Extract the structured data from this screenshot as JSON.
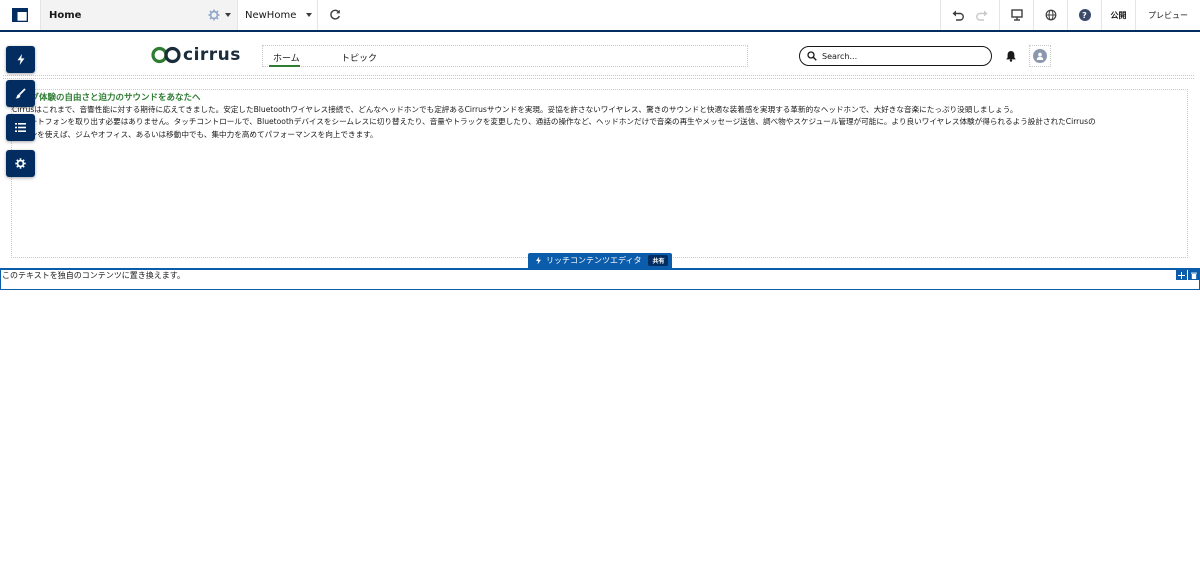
{
  "topbar": {
    "page_name": "Home",
    "view_name": "NewHome",
    "publish_label": "公開",
    "preview_label": "プレビュー"
  },
  "site": {
    "logo_text": "cirrus",
    "nav": [
      {
        "label": "ホーム",
        "active": true
      },
      {
        "label": "トピック",
        "active": false
      }
    ],
    "search_placeholder": "Search..."
  },
  "content": {
    "heading": "ング体験の自由さと迫力のサウンドをあなたへ",
    "lines": [
      "Cirrusはこれまで、音響性能に対する期待に応えてきました。安定したBluetoothワイヤレス接続で、どんなヘッドホンでも定評あるCirrusサウンドを実現。妥協を許さないワイヤレス、驚きのサウンドと快適な装着感を実現する革新的なヘッドホンで、大好きな音楽にたっぷり没頭しましょう。",
      "マートフォンを取り出す必要はありません。タッチコントロールで、Bluetoothデバイスをシームレスに切り替えたり、音量やトラックを変更したり、通話の操作など、ヘッドホンだけで音楽の再生やメッセージ送信、調べ物やスケジュール管理が可能に。より良いワイヤレス体験が得られるよう設計されたCirrusの",
      "ホンを使えば、ジムやオフィス、あるいは移動中でも、集中力を高めてパフォーマンスを向上できます。"
    ]
  },
  "rich_editor": {
    "label": "リッチコンテンツエディタ",
    "shared_badge": "共有",
    "placeholder_text": "このテキストを独自のコンテンツに置き換えます。"
  },
  "colors": {
    "brand_navy": "#032d60",
    "editor_blue": "#0b5cab",
    "heading_green": "#2e7d32"
  }
}
